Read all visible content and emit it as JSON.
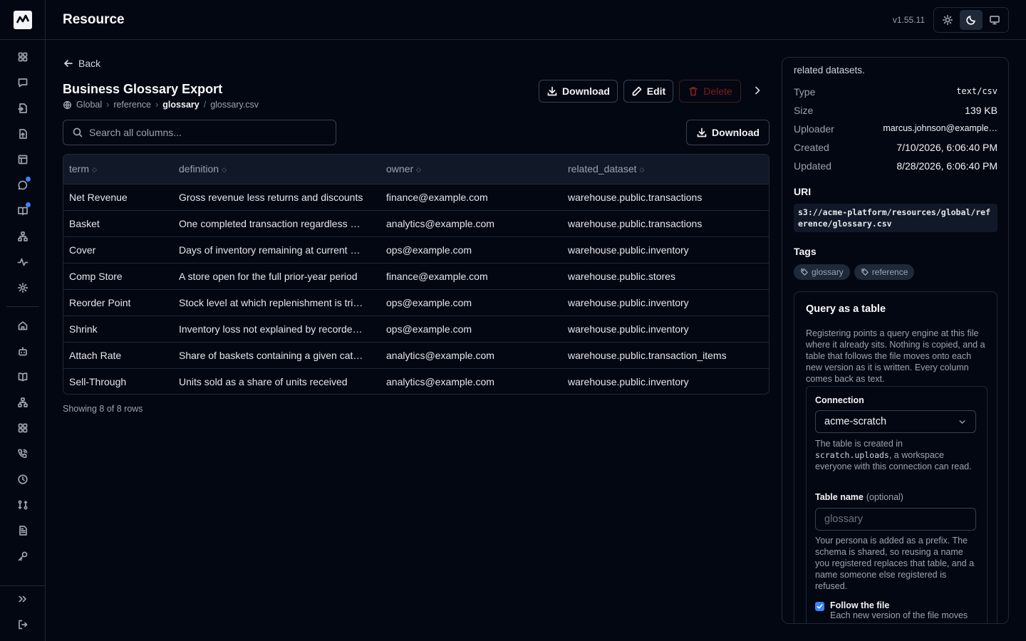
{
  "app": {
    "section_title": "Resource",
    "version": "v1.55.11"
  },
  "theme": {
    "options": [
      "light",
      "dark",
      "system"
    ],
    "active": "dark"
  },
  "sidebar": {
    "top_items": [
      "grid-icon",
      "chat-icon",
      "file-import-icon",
      "file-upload-icon",
      "table-icon",
      "chat-bubble-icon",
      "book-icon",
      "hierarchy-icon",
      "activity-icon",
      "settings-icon"
    ],
    "bottom_items": [
      "home-icon",
      "bot-icon",
      "book-open-icon",
      "hierarchy-icon",
      "grid-icon",
      "phone-icon",
      "clock-icon",
      "compare-icon",
      "document-icon",
      "key-icon"
    ],
    "expand_label": "expand",
    "logout_label": "logout"
  },
  "page": {
    "back_label": "Back",
    "title": "Business Glossary Export",
    "breadcrumb": {
      "scope": "Global",
      "level1": "reference",
      "level2": "glossary",
      "file": "glossary.csv"
    },
    "actions": {
      "download": "Download",
      "edit": "Edit",
      "delete": "Delete"
    }
  },
  "table": {
    "search_placeholder": "Search all columns...",
    "download_label": "Download",
    "columns": [
      "term",
      "definition",
      "owner",
      "related_dataset"
    ],
    "rows": [
      [
        "Net Revenue",
        "Gross revenue less returns and discounts",
        "finance@example.com",
        "warehouse.public.transactions"
      ],
      [
        "Basket",
        "One completed transaction regardless …",
        "analytics@example.com",
        "warehouse.public.transactions"
      ],
      [
        "Cover",
        "Days of inventory remaining at current …",
        "ops@example.com",
        "warehouse.public.inventory"
      ],
      [
        "Comp Store",
        "A store open for the full prior-year period",
        "finance@example.com",
        "warehouse.public.stores"
      ],
      [
        "Reorder Point",
        "Stock level at which replenishment is tri…",
        "ops@example.com",
        "warehouse.public.inventory"
      ],
      [
        "Shrink",
        "Inventory loss not explained by recorde…",
        "ops@example.com",
        "warehouse.public.inventory"
      ],
      [
        "Attach Rate",
        "Share of baskets containing a given cat…",
        "analytics@example.com",
        "warehouse.public.transaction_items"
      ],
      [
        "Sell-Through",
        "Units sold as a share of units received",
        "analytics@example.com",
        "warehouse.public.inventory"
      ]
    ],
    "row_count": "Showing 8 of 8 rows"
  },
  "details": {
    "description_tail": "related datasets.",
    "type_label": "Type",
    "type_value": "text/csv",
    "size_label": "Size",
    "size_value": "139 KB",
    "uploader_label": "Uploader",
    "uploader_value": "marcus.johnson@example…",
    "created_label": "Created",
    "created_value": "7/10/2026, 6:06:40 PM",
    "updated_label": "Updated",
    "updated_value": "8/28/2026, 6:06:40 PM",
    "uri_label": "URI",
    "uri_value": "s3://acme-platform/resources/global/reference/glossary.csv",
    "tags_label": "Tags",
    "tags": [
      "glossary",
      "reference"
    ]
  },
  "query": {
    "title": "Query as a table",
    "description": "Registering points a query engine at this file where it already sits. Nothing is copied, and a table that follows the file moves onto each new version as it is written. Every column comes back as text.",
    "connection_label": "Connection",
    "connection_value": "acme-scratch",
    "connection_help_prefix": "The table is created in",
    "connection_help_code": "scratch.uploads",
    "connection_help_suffix": ", a workspace everyone with this connection can read.",
    "table_name_label": "Table name",
    "table_name_optional": "(optional)",
    "table_name_placeholder": "glossary",
    "table_name_help": "Your persona is added as a prefix. The schema is shared, so reusing a name you registered replaces that table, and a name someone else registered is refused.",
    "follow_label": "Follow the file",
    "follow_help": "Each new version of the file moves",
    "follow_checked": true
  }
}
